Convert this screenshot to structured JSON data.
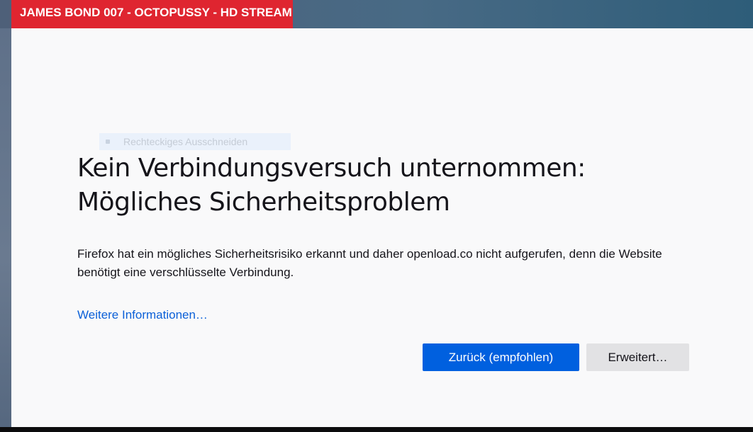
{
  "header": {
    "title": "JAMES BOND 007 - OCTOPUSSY - HD STREAM"
  },
  "ghost_menu": {
    "label": "Rechteckiges Ausschneiden"
  },
  "error_page": {
    "title_line1": "Kein Verbindungsversuch unternommen:",
    "title_line2": "Mögliches Sicherheitsproblem",
    "description": "Firefox hat ein mögliches Sicherheitsrisiko erkannt und daher openload.co nicht aufgerufen, denn die Website benötigt eine verschlüsselte Verbindung.",
    "learn_more": "Weitere Informationen…",
    "buttons": {
      "back": "Zurück (empfohlen)",
      "advanced": "Erweitert…"
    }
  },
  "colors": {
    "header_badge": "#df2530",
    "primary_button": "#0060df",
    "link": "#0a60d8",
    "page_background": "#f9f9fa"
  }
}
